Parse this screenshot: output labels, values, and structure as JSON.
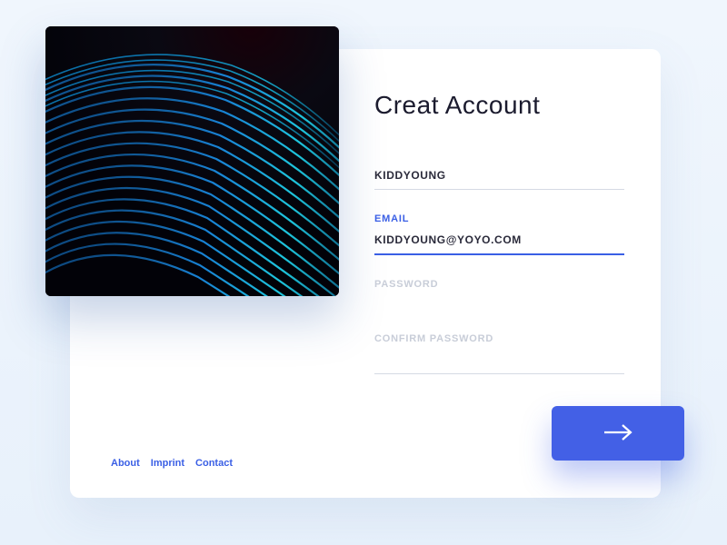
{
  "title": "Creat Account",
  "fields": {
    "name": {
      "value": "KIDDYOUNG"
    },
    "email": {
      "label": "EMAIL",
      "value": "KIDDYOUNG@yoyo.COM"
    },
    "password": {
      "label": "PASSWORD",
      "value": ""
    },
    "confirm": {
      "label": "CONFIRM PASSWORD",
      "value": ""
    }
  },
  "footer": {
    "about": "About",
    "imprint": "Imprint",
    "contact": "Contact"
  }
}
